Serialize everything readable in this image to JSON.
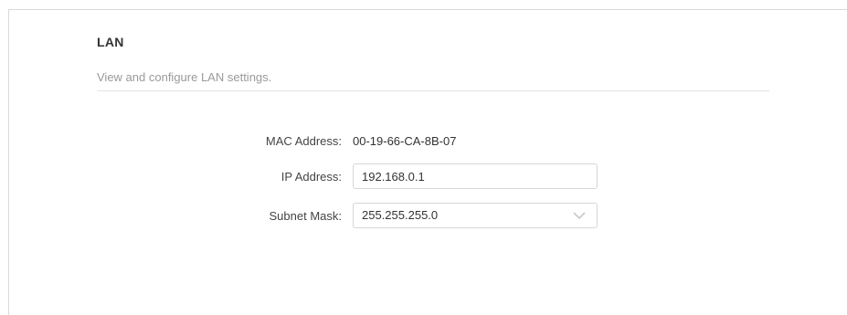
{
  "section": {
    "title": "LAN",
    "description": "View and configure LAN settings."
  },
  "fields": {
    "mac": {
      "label": "MAC Address:",
      "value": "00-19-66-CA-8B-07"
    },
    "ip": {
      "label": "IP Address:",
      "value": "192.168.0.1"
    },
    "subnet": {
      "label": "Subnet Mask:",
      "value": "255.255.255.0",
      "icon": "chevron-down-icon"
    }
  },
  "colors": {
    "title": "#333333",
    "description": "#9a9a9a",
    "border": "#d6d6d6",
    "chevron": "#c8c8c8"
  }
}
